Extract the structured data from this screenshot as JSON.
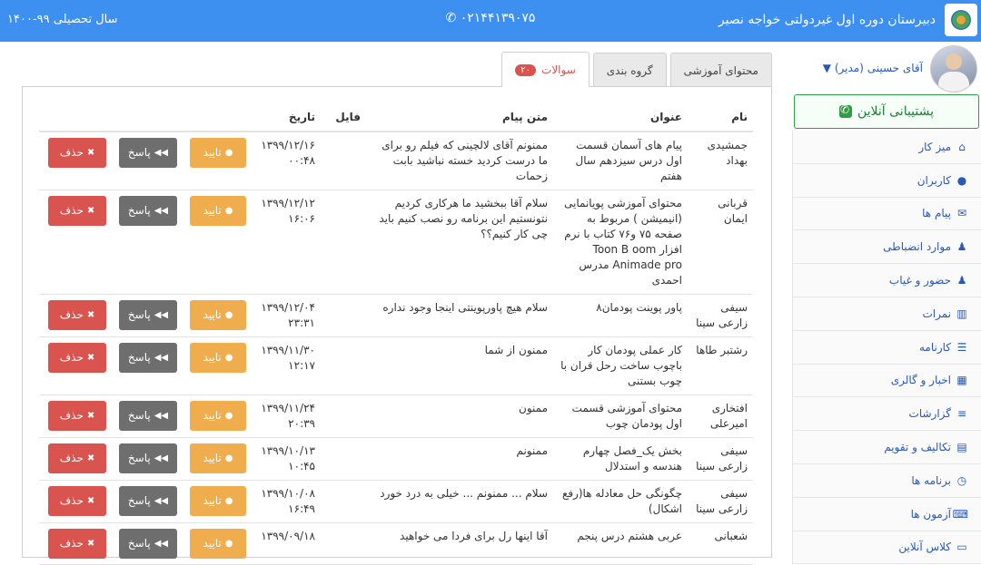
{
  "header": {
    "school_name": "دبیرستان دوره اول غیردولتی خواجه نصیر",
    "phone": "۰۲۱۴۴۱۳۹۰۷۵",
    "academic_year": "سال تحصیلی ۹۹-۱۴۰۰",
    "phone_icon": "phone-icon",
    "logo_icon": "school-logo-icon"
  },
  "sidebar": {
    "user_name": "آقای حسینی (مدیر)",
    "support_label": "پشتیبانی آنلاین",
    "items": [
      {
        "label": "میز کار",
        "icon": "home-icon"
      },
      {
        "label": "کاربران",
        "icon": "user-icon"
      },
      {
        "label": "پیام ها",
        "icon": "envelope-icon"
      },
      {
        "label": "موارد انضباطی",
        "icon": "users-icon"
      },
      {
        "label": "حضور و غیاب",
        "icon": "users-icon"
      },
      {
        "label": "نمرات",
        "icon": "bar-chart-icon"
      },
      {
        "label": "کارنامه",
        "icon": "list-icon"
      },
      {
        "label": "اخبار و گالری",
        "icon": "film-icon"
      },
      {
        "label": "گزارشات",
        "icon": "report-icon"
      },
      {
        "label": "تکالیف و تقویم",
        "icon": "calendar-icon"
      },
      {
        "label": "برنامه ها",
        "icon": "clock-icon"
      },
      {
        "label": "آزمون ها",
        "icon": "keyboard-icon"
      },
      {
        "label": "کلاس آنلاین",
        "icon": "laptop-icon"
      }
    ]
  },
  "tabs": [
    {
      "label": "محتوای آموزشی",
      "active": false
    },
    {
      "label": "گروه بندی",
      "active": false
    },
    {
      "label": "سوالات",
      "badge": "۲۰",
      "active": true
    }
  ],
  "table": {
    "headers": {
      "name": "نام",
      "title": "عنوان",
      "message": "متن پیام",
      "file": "فایل",
      "date": "تاریخ"
    },
    "buttons": {
      "approve": "تایید",
      "reply": "پاسخ",
      "delete": "حذف"
    },
    "rows": [
      {
        "name": "جمشیدی بهداد",
        "title": "پیام های آسمان قسمت اول درس سیزدهم سال هفتم",
        "message": "ممنونم آقای لالچینی که فیلم رو برای ما درست کردید خسته نباشید بابت زحمات",
        "file": "",
        "date": "۱۳۹۹/۱۲/۱۶",
        "time": "۰۰:۴۸"
      },
      {
        "name": "قربانی ایمان",
        "title": "محتوای آموزشی پویانمایی (انیمیشن ) مربوط به صفحه ۷۵ و۷۶ کتاب با نرم افزار Toon B oom Animade pro مدرس احمدی",
        "message": "سلام آقا ببخشید ما هرکاری کردیم نتونستیم این برنامه رو نصب کنیم باید چی کار کنیم؟؟",
        "file": "",
        "date": "۱۳۹۹/۱۲/۱۲",
        "time": "۱۶:۰۶"
      },
      {
        "name": "سیفی زارعی سینا",
        "title": "پاور پوینت پودمان۸",
        "message": "سلام هیچ پاورپوینتی اینجا وجود نداره",
        "file": "",
        "date": "۱۳۹۹/۱۲/۰۴",
        "time": "۲۳:۳۱"
      },
      {
        "name": "رشتبر طاها",
        "title": "کار عملی پودمان کار باچوب ساخت رحل قران با چوب بستنی",
        "message": "ممنون از شما",
        "file": "",
        "date": "۱۳۹۹/۱۱/۳۰",
        "time": "۱۲:۱۷"
      },
      {
        "name": "افتخاری امیرعلی",
        "title": "محتوای آموزشی قسمت اول پودمان چوب",
        "message": "ممنون",
        "file": "",
        "date": "۱۳۹۹/۱۱/۲۴",
        "time": "۲۰:۳۹"
      },
      {
        "name": "سیفی زارعی سینا",
        "title": "بخش یک_فصل چهارم هندسه و استدلال",
        "message": "ممنونم",
        "file": "",
        "date": "۱۳۹۹/۱۰/۱۳",
        "time": "۱۰:۴۵"
      },
      {
        "name": "سیفی زارعی سینا",
        "title": "چگونگی حل معادله ها(رفع اشکال)",
        "message": "سلام ... ممنونم ... خیلی به درد خورد",
        "file": "",
        "date": "۱۳۹۹/۱۰/۰۸",
        "time": "۱۶:۴۹"
      },
      {
        "name": "شعبانی",
        "title": "عربی هشتم درس پنجم",
        "message": "آقا اینها رل برای فردا می خواهید",
        "file": "",
        "date": "۱۳۹۹/۰۹/۱۸",
        "time": ""
      }
    ]
  }
}
